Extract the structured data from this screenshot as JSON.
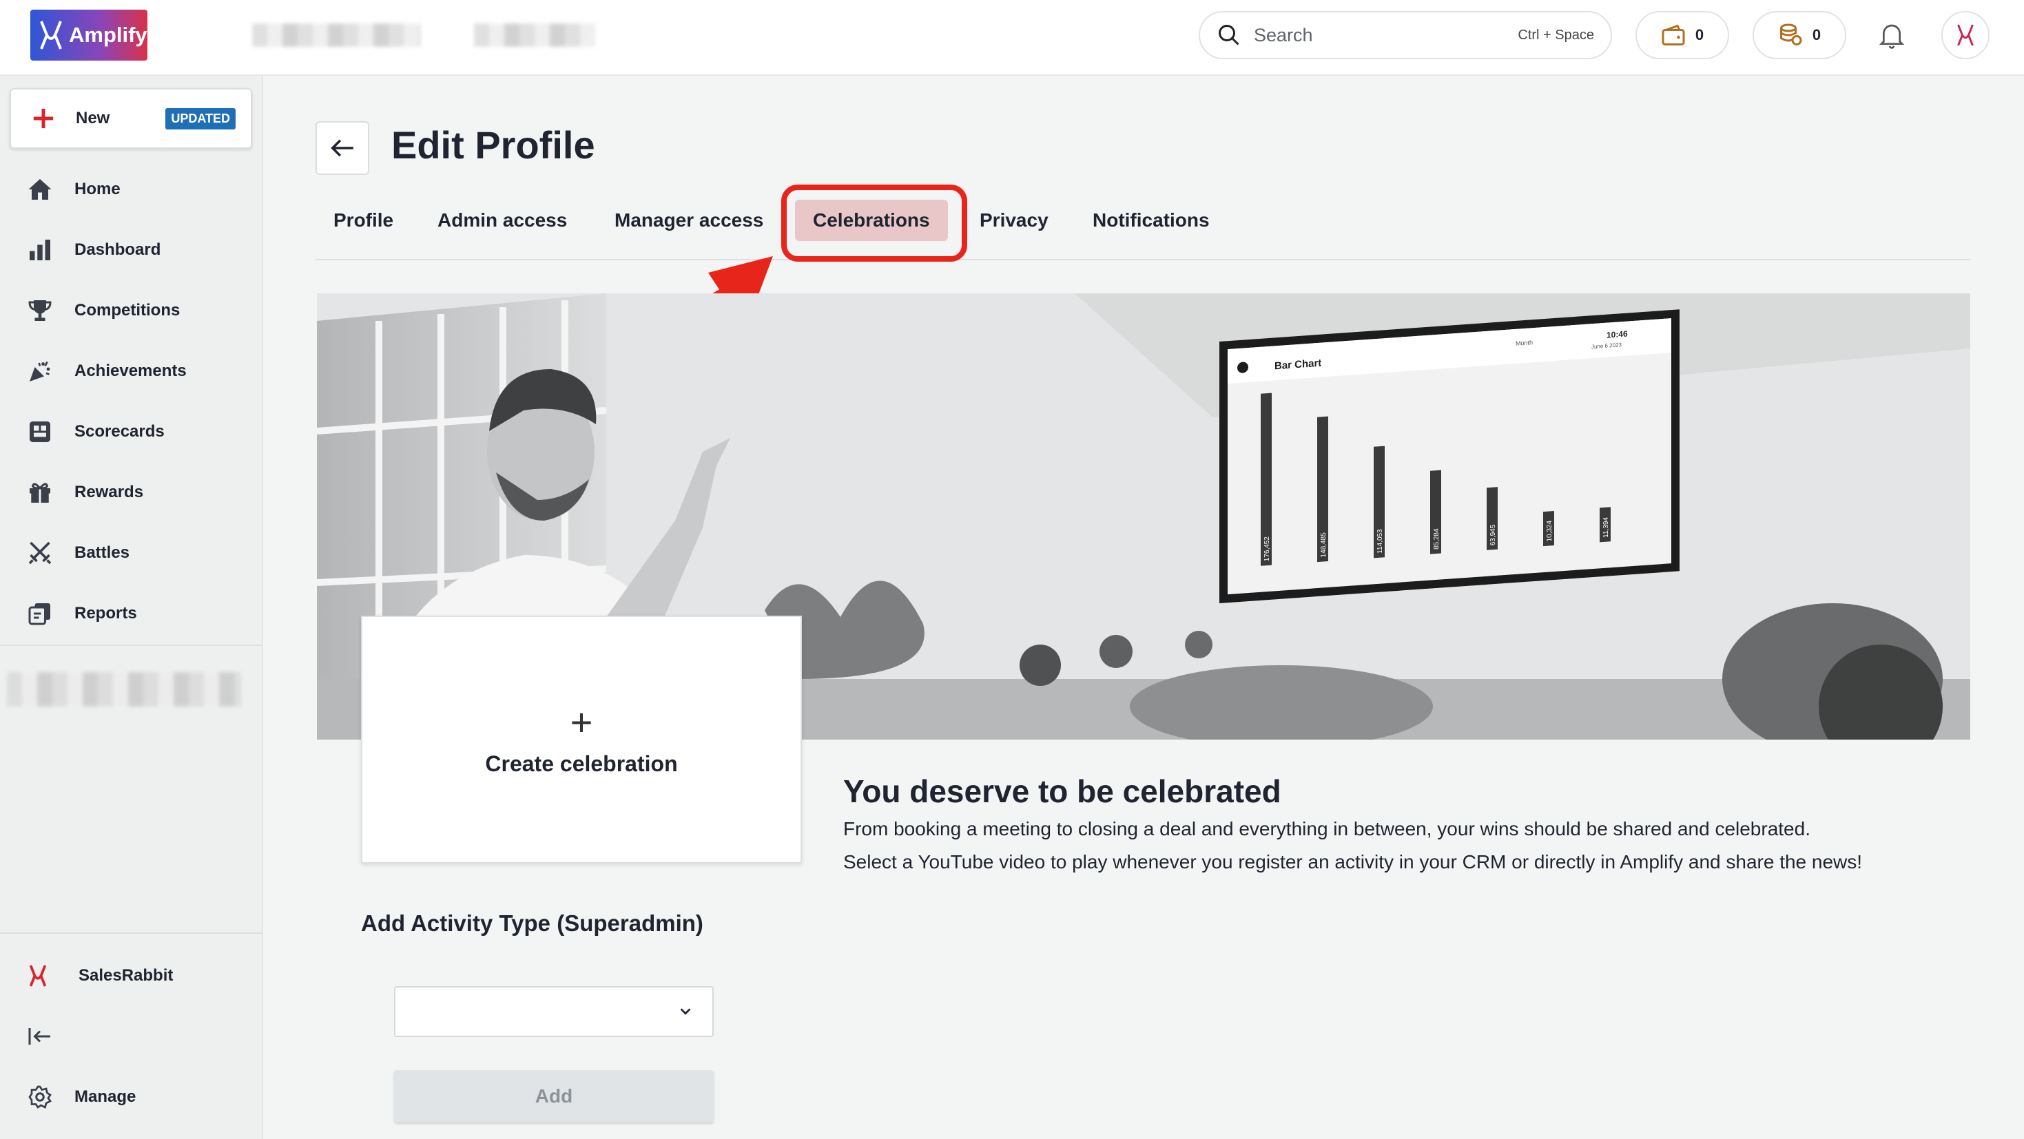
{
  "app": {
    "brand": "Amplify",
    "accent": "#e8251b"
  },
  "header": {
    "search_placeholder": "Search",
    "search_shortcut": "Ctrl + Space",
    "wallet_count": "0",
    "coins_count": "0",
    "icons": [
      "search-icon",
      "wallet-icon",
      "coins-icon",
      "bell-icon",
      "avatar"
    ]
  },
  "sidebar": {
    "new_label": "New",
    "new_badge": "UPDATED",
    "items": [
      {
        "label": "Home",
        "icon": "home-icon"
      },
      {
        "label": "Dashboard",
        "icon": "bar-chart-icon"
      },
      {
        "label": "Competitions",
        "icon": "trophy-icon"
      },
      {
        "label": "Achievements",
        "icon": "party-popper-icon"
      },
      {
        "label": "Scorecards",
        "icon": "scorecard-icon"
      },
      {
        "label": "Rewards",
        "icon": "gift-icon"
      },
      {
        "label": "Battles",
        "icon": "crossed-swords-icon"
      },
      {
        "label": "Reports",
        "icon": "reports-icon"
      }
    ],
    "org_name": "SalesRabbit",
    "manage_label": "Manage"
  },
  "page": {
    "title": "Edit Profile",
    "tabs": [
      "Profile",
      "Admin access",
      "Manager access",
      "Celebrations",
      "Privacy",
      "Notifications"
    ],
    "active_tab": "Celebrations"
  },
  "hero_chart": {
    "title": "Bar Chart",
    "time": "10:46",
    "date": "June 6 2023",
    "period": "Month",
    "values": [
      "176,452",
      "148,485",
      "114,053",
      "85,284",
      "63,945",
      "10,324",
      "11,394"
    ]
  },
  "celebrations": {
    "create_label": "Create celebration",
    "headline": "You deserve to be celebrated",
    "desc_1": "From booking a meeting to closing a deal and everything in between, your wins should be shared and celebrated.",
    "desc_2": "Select a YouTube video to play whenever you register an activity in your CRM or directly in Amplify and share the news!",
    "activity_title": "Add Activity Type (Superadmin)",
    "select_value": "",
    "add_label": "Add"
  }
}
